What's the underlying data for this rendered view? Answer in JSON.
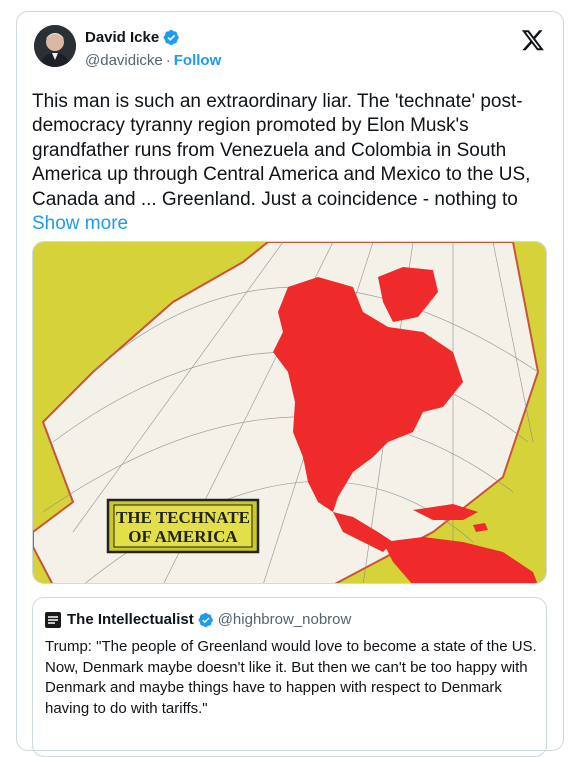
{
  "author": {
    "name": "David Icke",
    "handle": "@davidicke",
    "separator": "·",
    "follow_label": "Follow"
  },
  "tweet": {
    "text": "This man is such an extraordinary liar. The 'technate' post-democracy tyranny region promoted by Elon Musk's grandfather runs from Venezuela and Colombia in South America up through Central America and Mexico to the US, Canada and ... Greenland. Just a coincidence - nothing to",
    "show_more_label": "Show more"
  },
  "media": {
    "sign_line1": "THE TECHNATE",
    "sign_line2": "OF AMERICA",
    "colors": {
      "background": "#d6d23a",
      "map": "#f4f1e8",
      "region": "#ee2a2a"
    }
  },
  "quote": {
    "name": "The Intellectualist",
    "handle": "@highbrow_nobrow",
    "text": "Trump: \"The people of Greenland would love to become a state of the US. Now, Denmark maybe doesn't like it. But then we can't be too happy with Denmark and maybe things have to happen with respect to Denmark having to do with tariffs.\""
  },
  "colors": {
    "accent": "#1d9bf0",
    "text": "#0f1419",
    "muted": "#536471",
    "border": "#cfd9de"
  }
}
